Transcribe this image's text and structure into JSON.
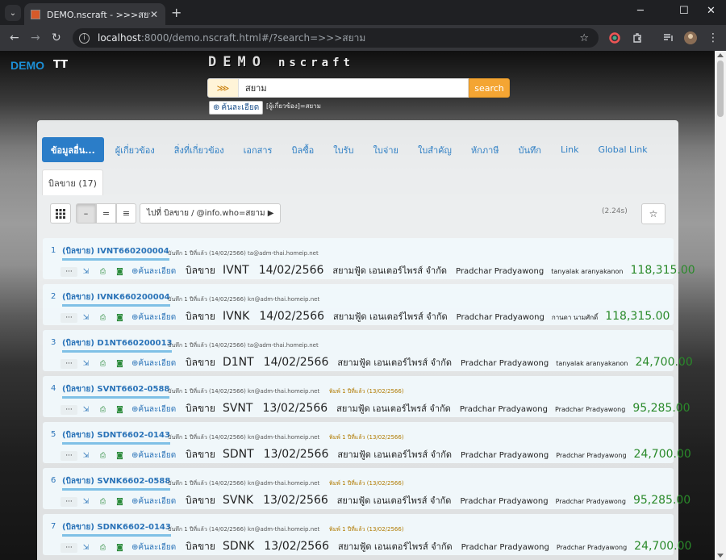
{
  "browser": {
    "tab_title": "DEMO.nscraft - >>>สยาม",
    "url_host": "localhost",
    "url_rest": ":8000/demo.nscraft.html#/?search=>>>สยาม"
  },
  "header": {
    "brand": "DEMO",
    "brand_icon": "TT",
    "logo_main": "DEMO",
    "logo_sub": "nscraft",
    "search_prefix": "⋙",
    "search_value": "สยาม",
    "search_button": "search",
    "detail_button": "ค้นละเอียด",
    "hint": "[ผู้เกี่ยวข้อง]=สยาม"
  },
  "nav": {
    "tabs": [
      "ข้อมูลอื่น...",
      "ผู้เกี่ยวข้อง",
      "สิ่งที่เกี่ยวข้อง",
      "เอกสาร",
      "บิลซื้อ",
      "ใบรับ",
      "ใบจ่าย",
      "ใบสำคัญ",
      "หักภาษี",
      "บันทึก",
      "Link",
      "Global Link"
    ],
    "subtab": "บิลขาย (17)"
  },
  "toolbar": {
    "grid_icon": "grid-icon",
    "view_labels": [
      "–",
      "=",
      "≡"
    ],
    "goto_label": "ไปที่ บิลขาย / @info.who=สยาม ▶",
    "timing": "(2.24s)",
    "star": "☆"
  },
  "rows": [
    {
      "num": "1",
      "docid": "(บิลขาย) IVNT660200004",
      "meta": "บันทึก 1 ปีที่แล้ว (14/02/2566) ta@adm-thai.homeip.net",
      "print": "",
      "type": "บิลขาย",
      "code": "IVNT",
      "date": "14/02/2566",
      "customer": "สยามฟู้ด เอนเตอร์ไพรส์ จำกัด",
      "rep": "Pradchar Pradyawong",
      "who": "tanyalak aranyakanon",
      "amount": "118,315.00"
    },
    {
      "num": "2",
      "docid": "(บิลขาย) IVNK660200004",
      "meta": "บันทึก 1 ปีที่แล้ว (14/02/2566) kn@adm-thai.homeip.net",
      "print": "",
      "type": "บิลขาย",
      "code": "IVNK",
      "date": "14/02/2566",
      "customer": "สยามฟู้ด เอนเตอร์ไพรส์ จำกัด",
      "rep": "Pradchar Pradyawong",
      "who": "กานดา นามศักดิ์",
      "amount": "118,315.00"
    },
    {
      "num": "3",
      "docid": "(บิลขาย) D1NT660200013",
      "meta": "บันทึก 1 ปีที่แล้ว (14/02/2566) ta@adm-thai.homeip.net",
      "print": "",
      "type": "บิลขาย",
      "code": "D1NT",
      "date": "14/02/2566",
      "customer": "สยามฟู้ด เอนเตอร์ไพรส์ จำกัด",
      "rep": "Pradchar Pradyawong",
      "who": "tanyalak aranyakanon",
      "amount": "24,700.00"
    },
    {
      "num": "4",
      "docid": "(บิลขาย) SVNT6602-0588",
      "meta": "บันทึก 1 ปีที่แล้ว (14/02/2566) kn@adm-thai.homeip.net",
      "print": "พิมพ์ 1 ปีที่แล้ว (13/02/2566)",
      "type": "บิลขาย",
      "code": "SVNT",
      "date": "13/02/2566",
      "customer": "สยามฟู้ด เอนเตอร์ไพรส์ จำกัด",
      "rep": "Pradchar Pradyawong",
      "who": "Pradchar Pradyawong",
      "amount": "95,285.00"
    },
    {
      "num": "5",
      "docid": "(บิลขาย) SDNT6602-0143",
      "meta": "บันทึก 1 ปีที่แล้ว (14/02/2566) kn@adm-thai.homeip.net",
      "print": "พิมพ์ 1 ปีที่แล้ว (13/02/2566)",
      "type": "บิลขาย",
      "code": "SDNT",
      "date": "13/02/2566",
      "customer": "สยามฟู้ด เอนเตอร์ไพรส์ จำกัด",
      "rep": "Pradchar Pradyawong",
      "who": "Pradchar Pradyawong",
      "amount": "24,700.00"
    },
    {
      "num": "6",
      "docid": "(บิลขาย) SVNK6602-0588",
      "meta": "บันทึก 1 ปีที่แล้ว (14/02/2566) kn@adm-thai.homeip.net",
      "print": "พิมพ์ 1 ปีที่แล้ว (13/02/2566)",
      "type": "บิลขาย",
      "code": "SVNK",
      "date": "13/02/2566",
      "customer": "สยามฟู้ด เอนเตอร์ไพรส์ จำกัด",
      "rep": "Pradchar Pradyawong",
      "who": "Pradchar Pradyawong",
      "amount": "95,285.00"
    },
    {
      "num": "7",
      "docid": "(บิลขาย) SDNK6602-0143",
      "meta": "บันทึก 1 ปีที่แล้ว (14/02/2566) kn@adm-thai.homeip.net",
      "print": "พิมพ์ 1 ปีที่แล้ว (13/02/2566)",
      "type": "บิลขาย",
      "code": "SDNK",
      "date": "13/02/2566",
      "customer": "สยามฟู้ด เอนเตอร์ไพรส์ จำกัด",
      "rep": "Pradchar Pradyawong",
      "who": "Pradchar Pradyawong",
      "amount": "24,700.00"
    }
  ],
  "row_actions": {
    "detail": "ค้นละเอียด",
    "dots": "···"
  },
  "colors": {
    "accent": "#2b7dc8",
    "search_button": "#f4a533",
    "amount": "#2a8a2a"
  }
}
